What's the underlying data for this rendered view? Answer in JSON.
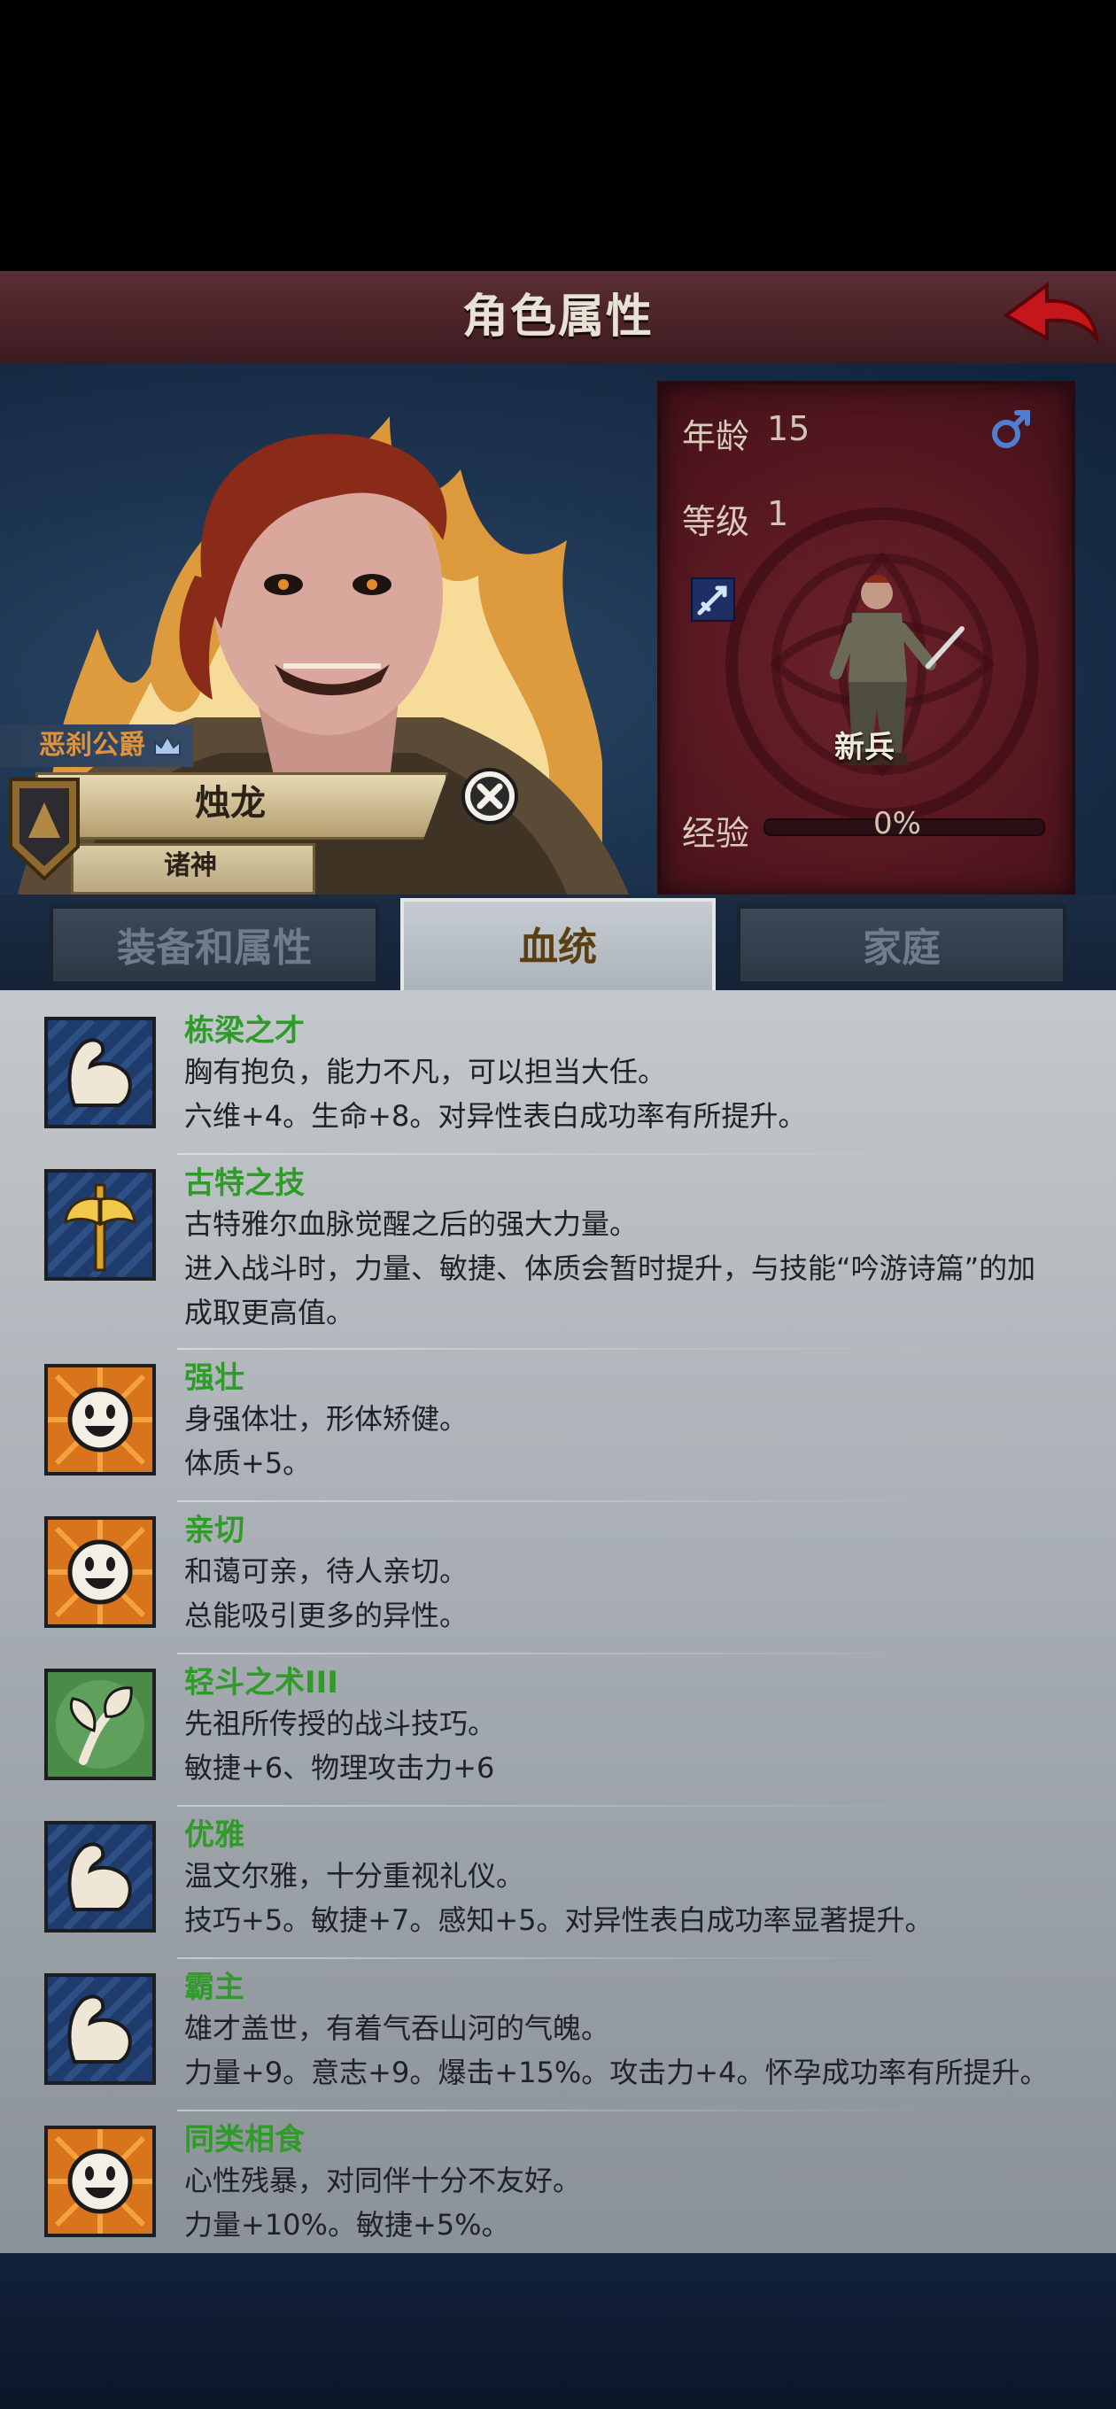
{
  "header": {
    "title": "角色属性"
  },
  "character": {
    "title_tag": "恶刹公爵",
    "name": "烛龙",
    "faction": "诸神"
  },
  "stats": {
    "age_label": "年龄",
    "age_value": "15",
    "level_label": "等级",
    "level_value": "1",
    "class_name": "新兵",
    "exp_label": "经验",
    "exp_value": "0%",
    "exp_progress": 0
  },
  "tabs": [
    {
      "label": "装备和属性",
      "active": false
    },
    {
      "label": "血统",
      "active": true
    },
    {
      "label": "家庭",
      "active": false
    }
  ],
  "traits": [
    {
      "icon": "muscle-arm-icon",
      "name": "栋梁之才",
      "lines": [
        "胸有抱负，能力不凡，可以担当大任。",
        "六维+4。生命+8。对异性表白成功率有所提升。"
      ]
    },
    {
      "icon": "golden-axe-icon",
      "name": "古特之技",
      "lines": [
        "古特雅尔血脉觉醒之后的强大力量。",
        "进入战斗时，力量、敏捷、体质会暂时提升，与技能“吟游诗篇”的加",
        "成取更高值。"
      ]
    },
    {
      "icon": "smiley-face-icon",
      "name": "强壮",
      "lines": [
        "身强体壮，形体矫健。",
        "体质+5。"
      ]
    },
    {
      "icon": "smiley-face-icon",
      "name": "亲切",
      "lines": [
        "和蔼可亲，待人亲切。",
        "总能吸引更多的异性。"
      ]
    },
    {
      "icon": "leaf-branch-icon",
      "name": "轻斗之术III",
      "lines": [
        "先祖所传授的战斗技巧。",
        "敏捷+6、物理攻击力+6"
      ]
    },
    {
      "icon": "muscle-arm-icon",
      "name": "优雅",
      "lines": [
        "温文尔雅，十分重视礼仪。",
        "技巧+5。敏捷+7。感知+5。对异性表白成功率显著提升。"
      ]
    },
    {
      "icon": "muscle-arm-icon",
      "name": "霸主",
      "lines": [
        "雄才盖世，有着气吞山河的气魄。",
        "力量+9。意志+9。爆击+15%。攻击力+4。怀孕成功率有所提升。"
      ]
    },
    {
      "icon": "smiley-face-icon",
      "name": "同类相食",
      "lines": [
        "心性残暴，对同伴十分不友好。",
        "力量+10%。敏捷+5%。"
      ]
    }
  ],
  "colors": {
    "header_bg": "#4a2329",
    "trait_name": "#2f9b28",
    "active_tab_text": "#5a3f12",
    "title_tag_text": "#e0933a"
  }
}
